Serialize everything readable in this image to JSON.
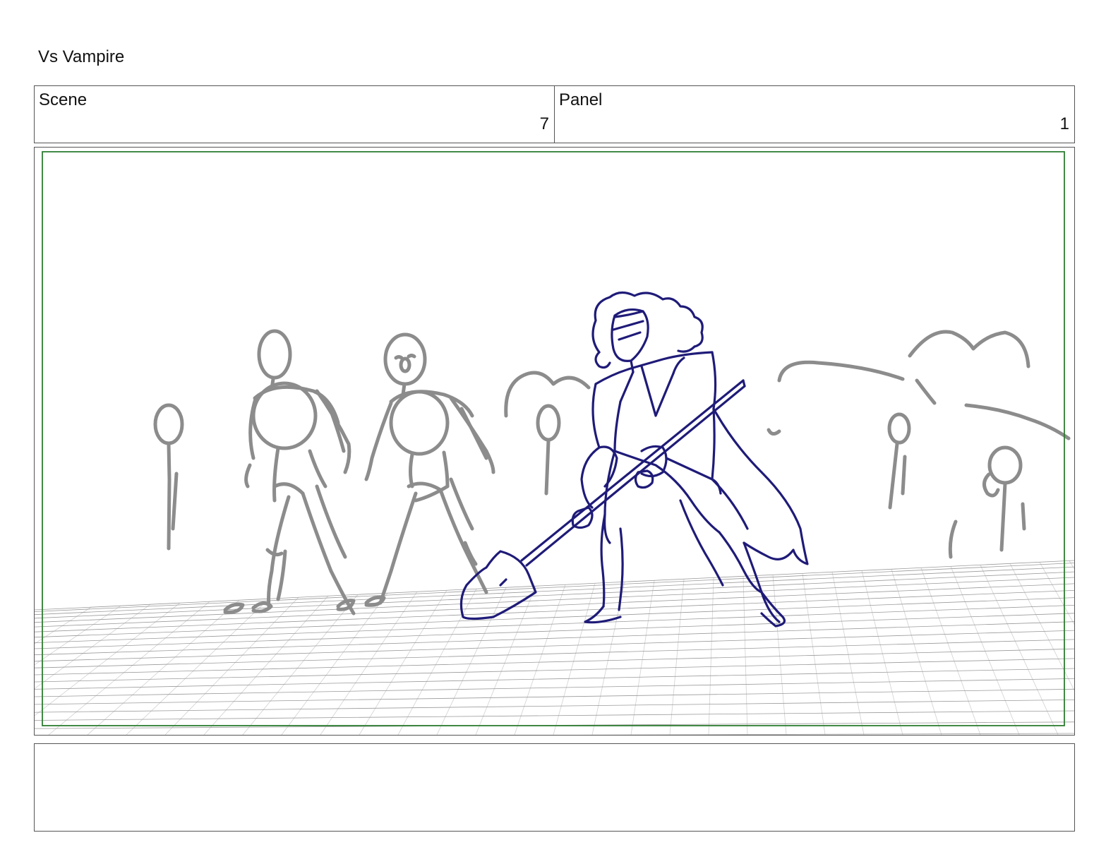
{
  "document": {
    "title": "Vs Vampire"
  },
  "info": {
    "scene_label": "Scene",
    "scene_value": "7",
    "panel_label": "Panel",
    "panel_value": "1"
  },
  "panel": {
    "safe_area_color": "#2e7d32",
    "rough_sketch_color": "#8c8c8c",
    "ink_sketch_color": "#1f1b78",
    "floor_grid_color": "#9a9a9a"
  },
  "notes": {
    "text": ""
  }
}
